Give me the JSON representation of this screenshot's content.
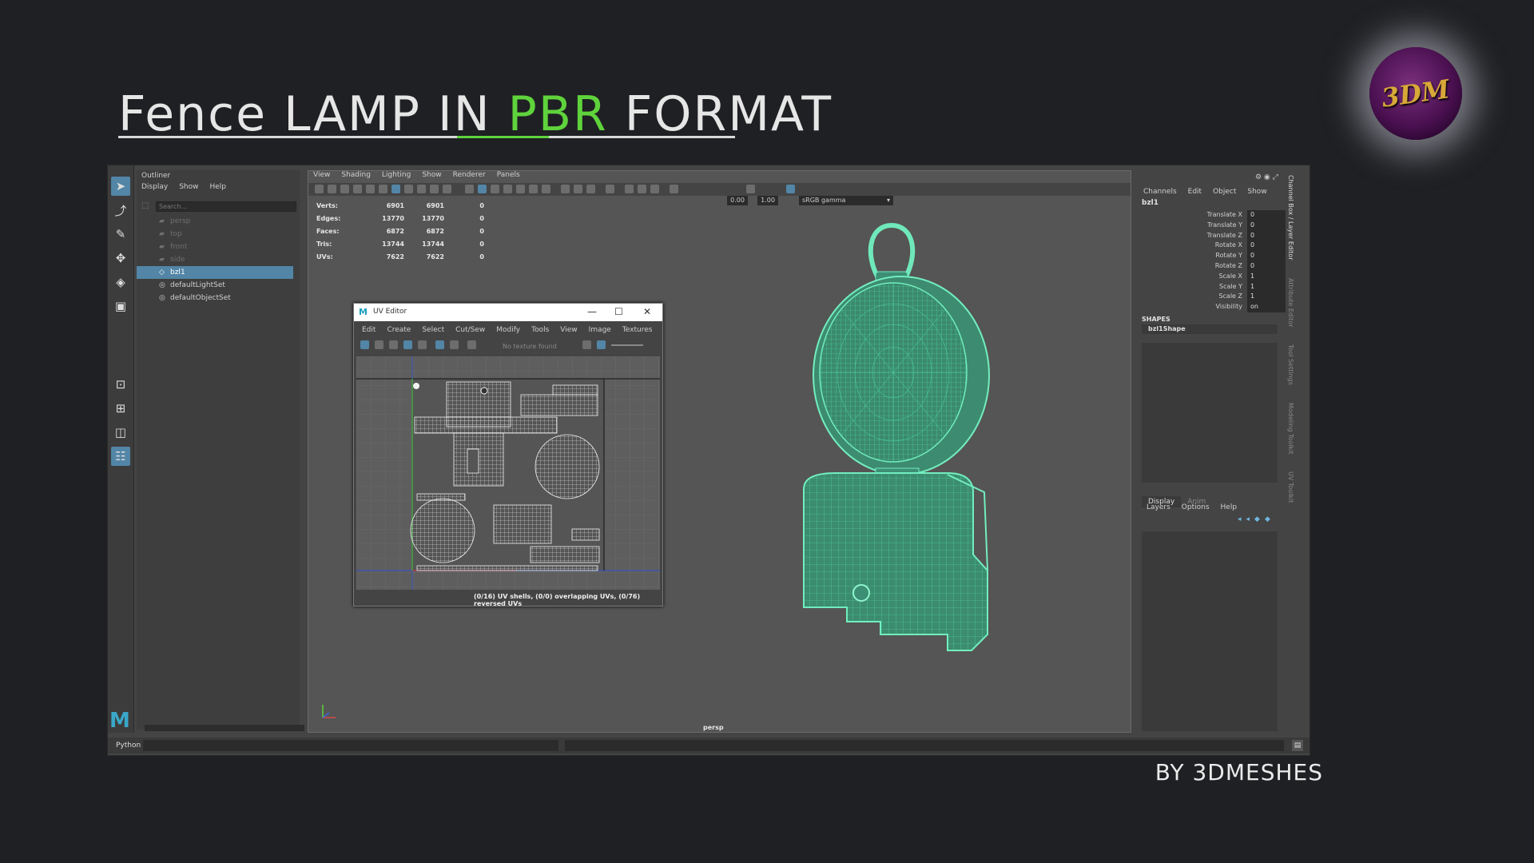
{
  "banner": {
    "title_pre": "Fence LAMP IN ",
    "title_hl": "PBR",
    "title_post": " FORMAT",
    "logo_text": "3DM",
    "byline": "BY 3DMESHES"
  },
  "outliner": {
    "title": "Outliner",
    "menu": [
      "Display",
      "Show",
      "Help"
    ],
    "search_placeholder": "Search...",
    "items": [
      {
        "label": "persp",
        "dim": true
      },
      {
        "label": "top",
        "dim": true
      },
      {
        "label": "front",
        "dim": true
      },
      {
        "label": "side",
        "dim": true
      },
      {
        "label": "bzl1",
        "selected": true
      },
      {
        "label": "defaultLightSet"
      },
      {
        "label": "defaultObjectSet"
      }
    ]
  },
  "viewport": {
    "menu": [
      "View",
      "Shading",
      "Lighting",
      "Show",
      "Renderer",
      "Panels"
    ],
    "field1": "0.00",
    "field2": "1.00",
    "colorspace": "sRGB gamma",
    "camera": "persp",
    "stats": [
      {
        "label": "Verts:",
        "a": "6901",
        "b": "6901",
        "c": "0"
      },
      {
        "label": "Edges:",
        "a": "13770",
        "b": "13770",
        "c": "0"
      },
      {
        "label": "Faces:",
        "a": "6872",
        "b": "6872",
        "c": "0"
      },
      {
        "label": "Tris:",
        "a": "13744",
        "b": "13744",
        "c": "0"
      },
      {
        "label": "UVs:",
        "a": "7622",
        "b": "7622",
        "c": "0"
      }
    ]
  },
  "uv_editor": {
    "title": "UV Editor",
    "menu": [
      "Edit",
      "Create",
      "Select",
      "Cut/Sew",
      "Modify",
      "Tools",
      "View",
      "Image",
      "Textures"
    ],
    "no_texture": "No texture found",
    "status": "(0/16) UV shells, (0/0) overlapping UVs, (0/76) reversed UVs"
  },
  "channel_box": {
    "menu": [
      "Channels",
      "Edit",
      "Object",
      "Show"
    ],
    "object": "bzl1",
    "attrs": [
      {
        "label": "Translate X",
        "value": "0"
      },
      {
        "label": "Translate Y",
        "value": "0"
      },
      {
        "label": "Translate Z",
        "value": "0"
      },
      {
        "label": "Rotate X",
        "value": "0"
      },
      {
        "label": "Rotate Y",
        "value": "0"
      },
      {
        "label": "Rotate Z",
        "value": "0"
      },
      {
        "label": "Scale X",
        "value": "1"
      },
      {
        "label": "Scale Y",
        "value": "1"
      },
      {
        "label": "Scale Z",
        "value": "1"
      },
      {
        "label": "Visibility",
        "value": "on"
      }
    ],
    "shapes_header": "SHAPES",
    "shape_name": "bzl1Shape",
    "layer_tabs": [
      "Display",
      "Anim"
    ],
    "layer_menu": [
      "Layers",
      "Options",
      "Help"
    ],
    "side_tabs": [
      "Channel Box / Layer Editor",
      "Attribute Editor",
      "Tool Settings",
      "Modeling Toolkit",
      "UV Toolkit"
    ]
  },
  "python_bar": {
    "label": "Python"
  },
  "colors": {
    "accent_green": "#5fd33c",
    "wire": "#5fe6b4",
    "select_blue": "#5285a6"
  }
}
